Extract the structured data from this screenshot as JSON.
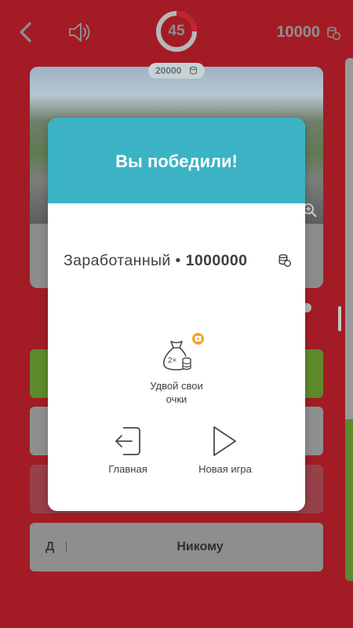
{
  "header": {
    "back_icon": "chevron-left-icon",
    "sound_icon": "speaker-icon",
    "timer_value": "45",
    "timer_progress": 0.25,
    "score": "10000",
    "coin_icon": "coins-icon"
  },
  "question": {
    "pot_value": "20000",
    "zoom_icon": "zoom-in-icon"
  },
  "answers": [
    {
      "letter": "",
      "text": ""
    },
    {
      "letter": "",
      "text": ""
    },
    {
      "letter": "",
      "text": ""
    },
    {
      "letter": "Д",
      "text": "Никому"
    }
  ],
  "modal": {
    "title": "Вы победили!",
    "earned_label": "Заработанный",
    "earned_separator": "•",
    "earned_value": "1000000",
    "double_label_line1": "Удвой свои",
    "double_label_line2": "очки",
    "double_icon_text": "2×",
    "home_label": "Главная",
    "new_game_label": "Новая игра"
  },
  "colors": {
    "background": "#a31c25",
    "modal_header": "#3bb3c4",
    "correct": "#5e8a2c",
    "video_badge": "#f5a623"
  }
}
